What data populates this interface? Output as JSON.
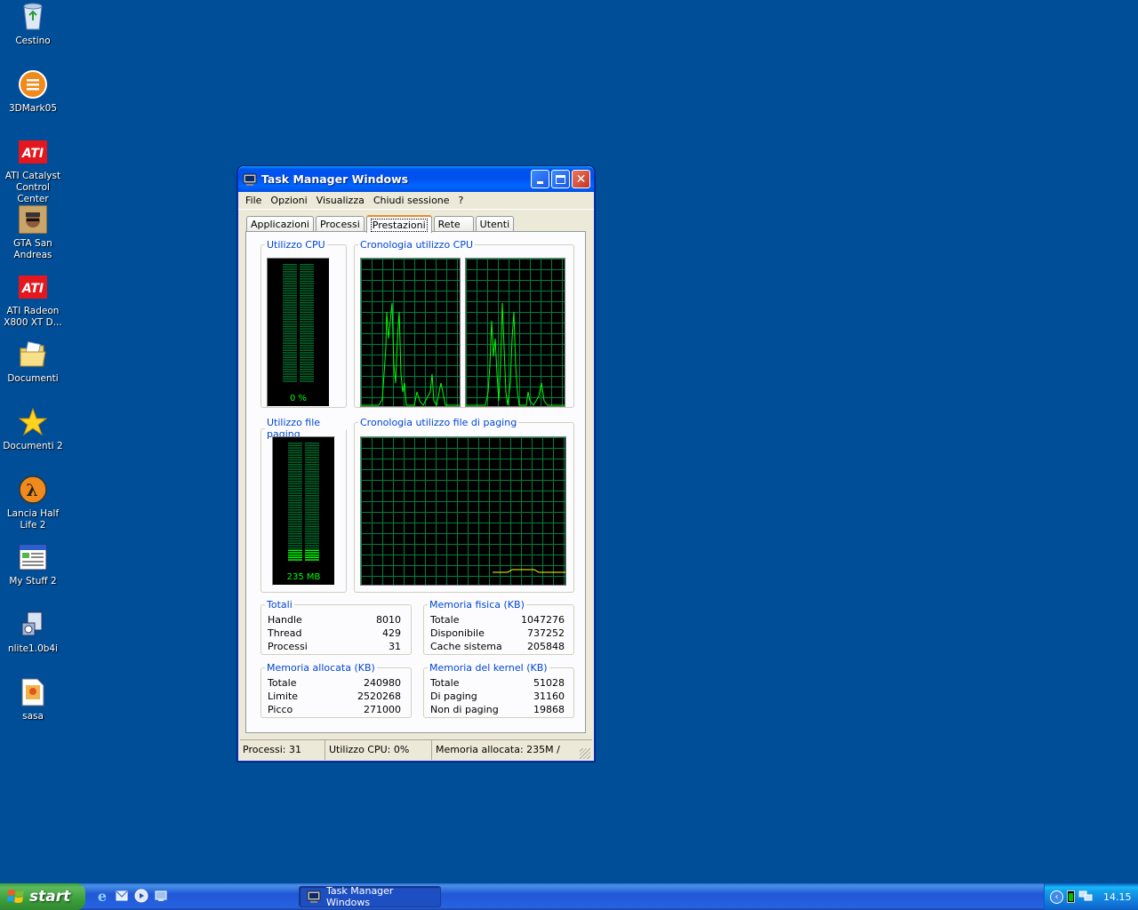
{
  "desktop": {
    "icons": [
      {
        "label": "Cestino",
        "icon": "recycle-bin-icon"
      },
      {
        "label": "3DMark05",
        "icon": "3dmark-icon"
      },
      {
        "label": "ATI Catalyst Control Center",
        "icon": "ati-icon"
      },
      {
        "label": "GTA San Andreas",
        "icon": "gta-icon"
      },
      {
        "label": "ATI Radeon X800 XT D...",
        "icon": "ati-icon"
      },
      {
        "label": "Documenti",
        "icon": "folder-icon"
      },
      {
        "label": "Documenti 2",
        "icon": "star-icon"
      },
      {
        "label": "Lancia Half Life 2",
        "icon": "half-life-icon"
      },
      {
        "label": "My Stuff 2",
        "icon": "window-app-icon"
      },
      {
        "label": "nlite1.0b4i",
        "icon": "installer-icon"
      },
      {
        "label": "sasa",
        "icon": "image-file-icon"
      }
    ]
  },
  "window": {
    "title": "Task Manager Windows",
    "menu": [
      "File",
      "Opzioni",
      "Visualizza",
      "Chiudi sessione",
      "?"
    ],
    "tabs": [
      "Applicazioni",
      "Processi",
      "Prestazioni",
      "Rete",
      "Utenti"
    ],
    "active_tab": "Prestazioni",
    "cpu_usage": {
      "legend": "Utilizzo CPU",
      "value": "0 %",
      "level": 0
    },
    "cpu_history": {
      "legend": "Cronologia utilizzo CPU"
    },
    "pf_usage": {
      "legend": "Utilizzo file paging",
      "value": "235 MB",
      "level": 0.09
    },
    "pf_history": {
      "legend": "Cronologia utilizzo file di paging"
    },
    "totals": {
      "legend": "Totali",
      "rows": [
        {
          "label": "Handle",
          "value": "8010"
        },
        {
          "label": "Thread",
          "value": "429"
        },
        {
          "label": "Processi",
          "value": "31"
        }
      ]
    },
    "physical": {
      "legend": "Memoria fisica (KB)",
      "rows": [
        {
          "label": "Totale",
          "value": "1047276"
        },
        {
          "label": "Disponibile",
          "value": "737252"
        },
        {
          "label": "Cache sistema",
          "value": "205848"
        }
      ]
    },
    "commit": {
      "legend": "Memoria allocata (KB)",
      "rows": [
        {
          "label": "Totale",
          "value": "240980"
        },
        {
          "label": "Limite",
          "value": "2520268"
        },
        {
          "label": "Picco",
          "value": "271000"
        }
      ]
    },
    "kernel": {
      "legend": "Memoria del kernel (KB)",
      "rows": [
        {
          "label": "Totale",
          "value": "51028"
        },
        {
          "label": "Di paging",
          "value": "31160"
        },
        {
          "label": "Non di paging",
          "value": "19868"
        }
      ]
    },
    "status": {
      "processes": "Processi: 31",
      "cpu": "Utilizzo CPU: 0%",
      "memory": "Memoria allocata: 235M /"
    }
  },
  "taskbar": {
    "start_label": "start",
    "task_item": "Task Manager Windows",
    "clock": "14.15"
  },
  "colors": {
    "desktop": "#004e98",
    "graph_line": "#00ff00",
    "graph_grid": "#008040",
    "pf_line": "#ffff00"
  }
}
